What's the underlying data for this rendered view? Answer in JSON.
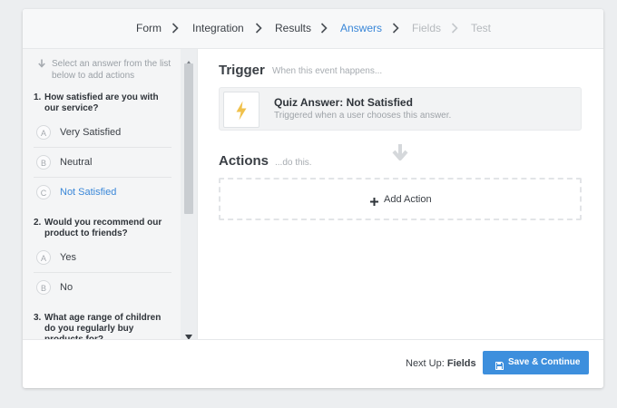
{
  "stepper": {
    "steps": [
      {
        "label": "Form",
        "state": "done"
      },
      {
        "label": "Integration",
        "state": "done"
      },
      {
        "label": "Results",
        "state": "done"
      },
      {
        "label": "Answers",
        "state": "active"
      },
      {
        "label": "Fields",
        "state": "todo"
      },
      {
        "label": "Test",
        "state": "todo"
      }
    ]
  },
  "sidebar": {
    "hint": "Select an answer from the list below to add actions",
    "questions": [
      {
        "number": "1.",
        "title": "How satisfied are you with our service?",
        "answers": [
          {
            "letter": "A",
            "label": "Very Satisfied"
          },
          {
            "letter": "B",
            "label": "Neutral"
          },
          {
            "letter": "C",
            "label": "Not Satisfied",
            "selected": true
          }
        ]
      },
      {
        "number": "2.",
        "title": "Would you recommend our product to friends?",
        "answers": [
          {
            "letter": "A",
            "label": "Yes"
          },
          {
            "letter": "B",
            "label": "No"
          }
        ]
      },
      {
        "number": "3.",
        "title": "What age range of children do you regularly buy products for?",
        "answers": []
      }
    ]
  },
  "trigger": {
    "heading": "Trigger",
    "subheading": "When this event happens...",
    "title": "Quiz Answer: Not Satisfied",
    "description": "Triggered when a user chooses this answer.",
    "icon": "lightning-icon"
  },
  "actions": {
    "heading": "Actions",
    "subheading": "...do this.",
    "add_label": "Add Action"
  },
  "footer": {
    "next_up_prefix": "Next Up:",
    "next_up_target": "Fields",
    "save_label": "Save & Continue"
  },
  "colors": {
    "accent": "#3d8fdd",
    "active_step": "#3a87d8",
    "lightning": "#f0c14b"
  }
}
